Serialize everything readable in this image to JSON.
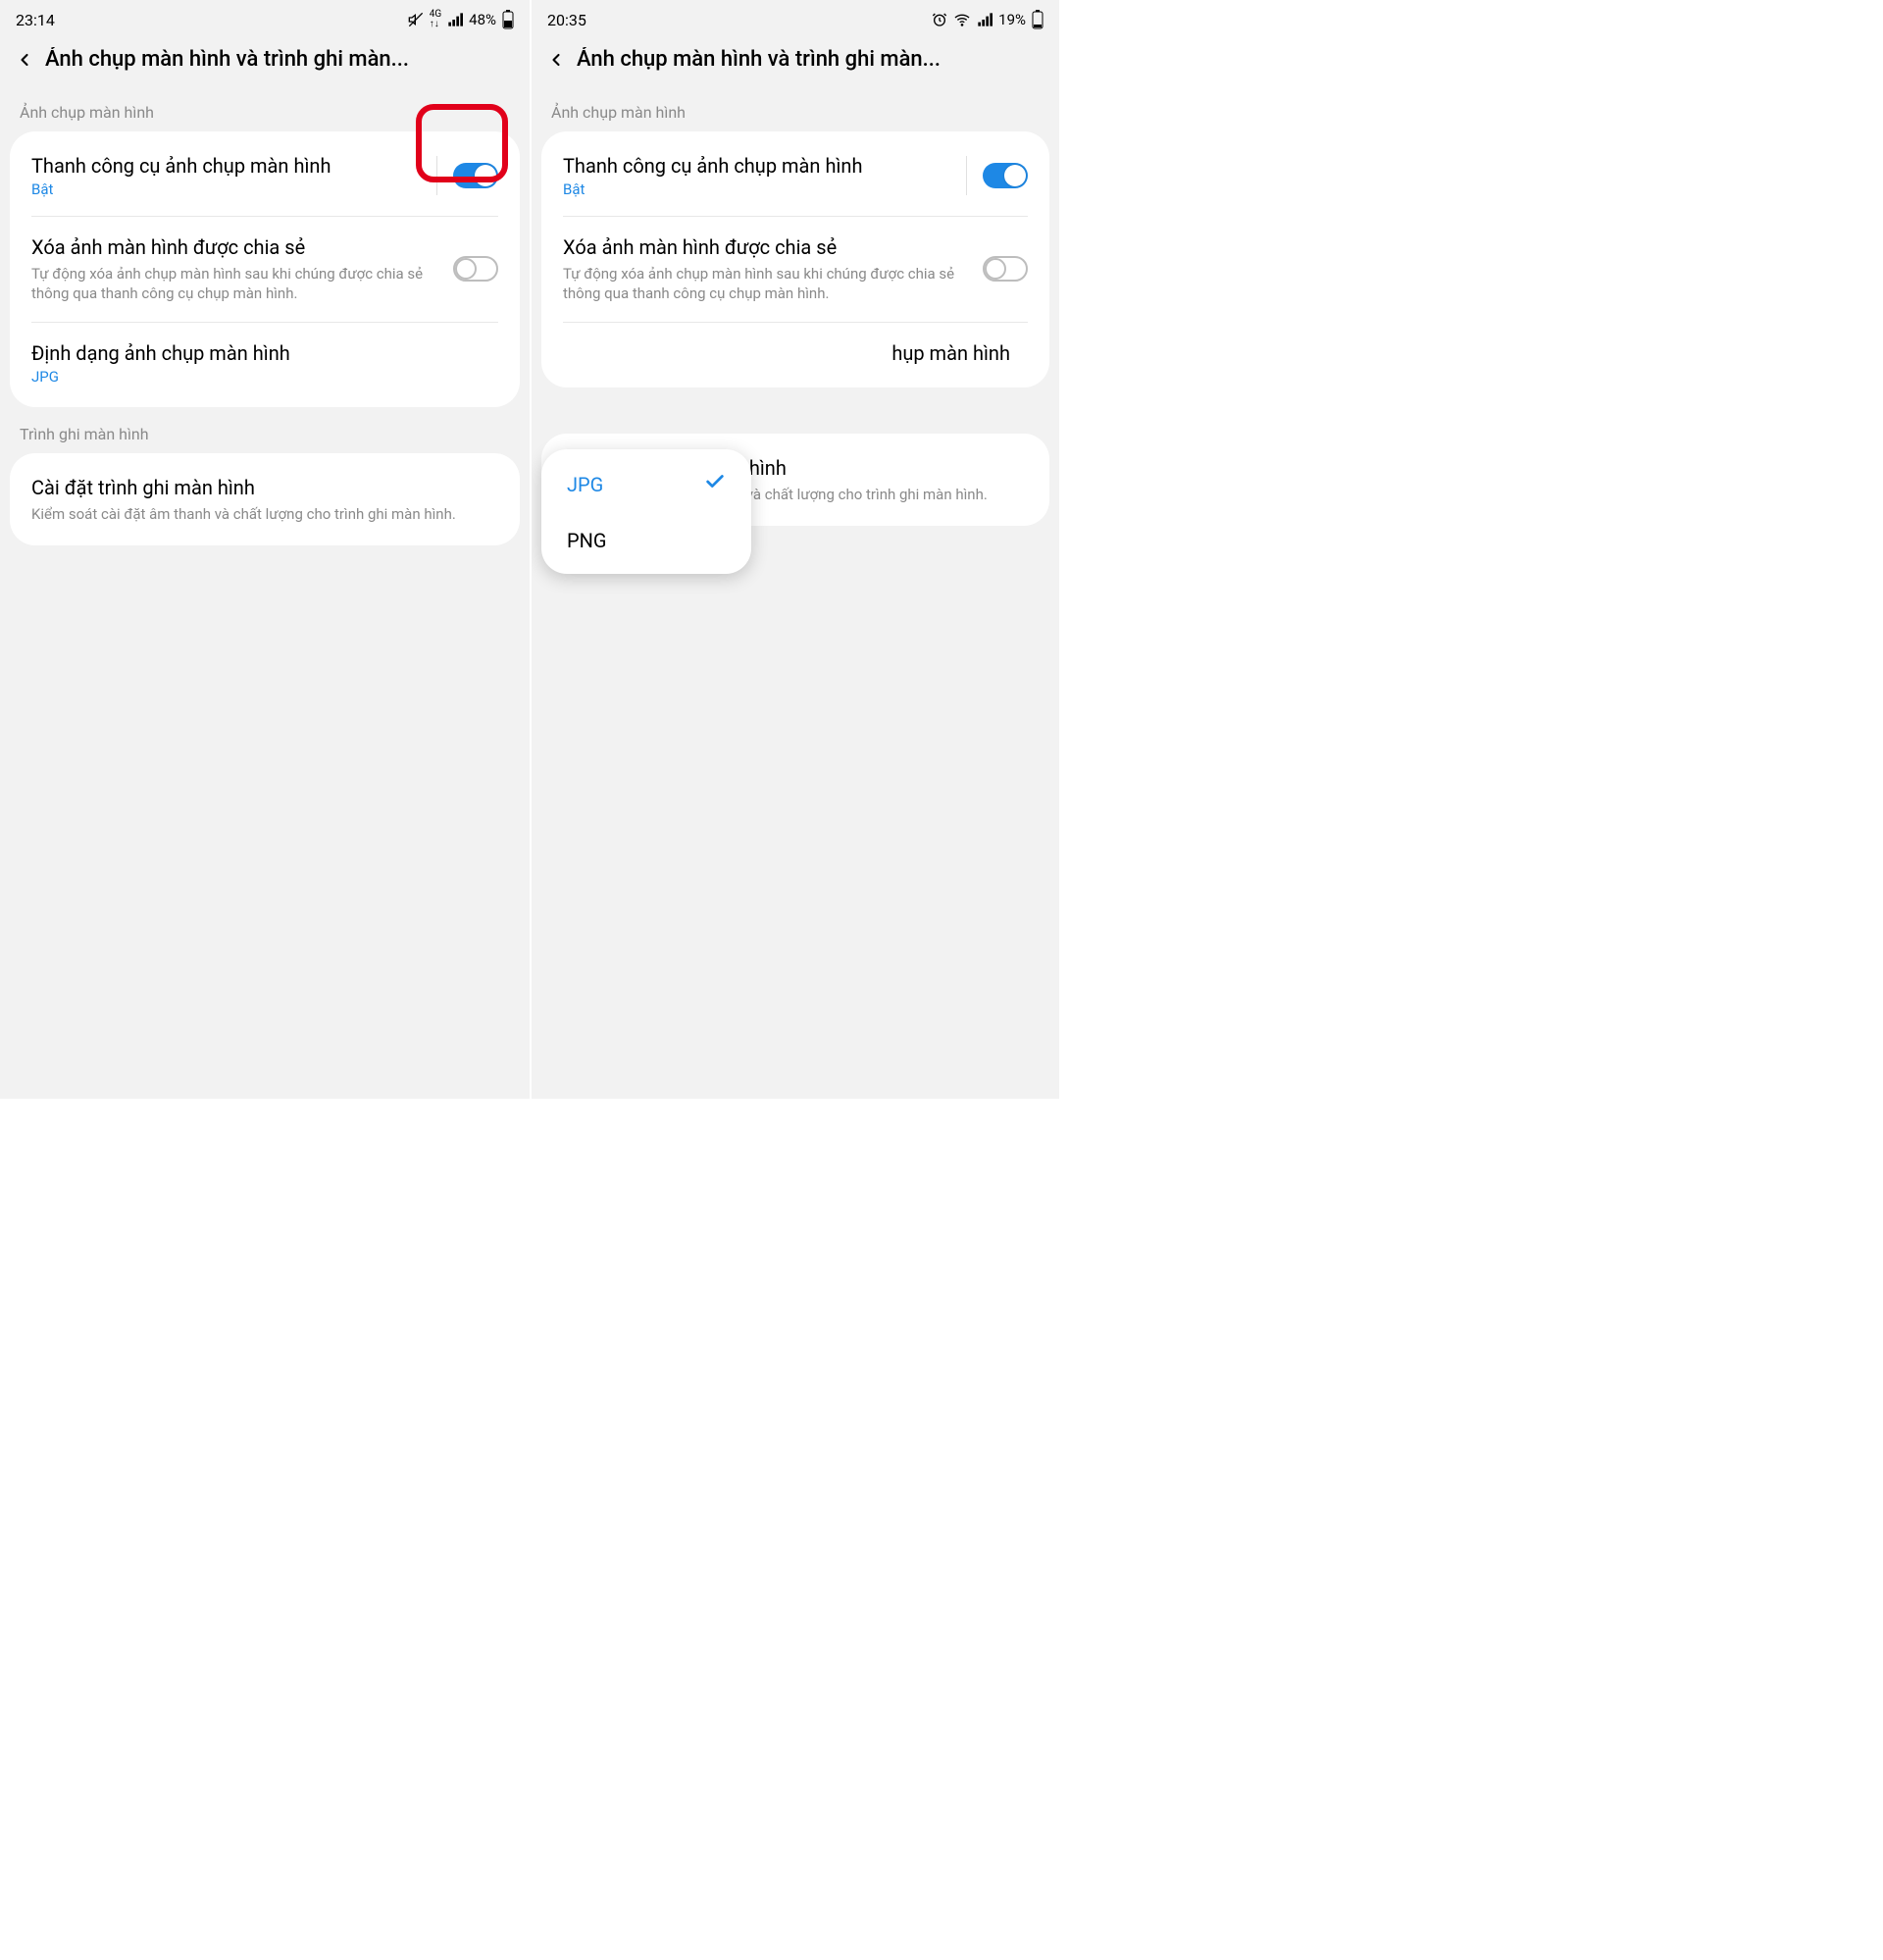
{
  "left": {
    "status": {
      "time": "23:14",
      "battery": "48%"
    },
    "header": {
      "title": "Ảnh chụp màn hình và trình ghi màn..."
    },
    "section1": {
      "label": "Ảnh chụp màn hình"
    },
    "row_toolbar": {
      "title": "Thanh công cụ ảnh chụp màn hình",
      "sub": "Bật"
    },
    "row_delete": {
      "title": "Xóa ảnh màn hình được chia sẻ",
      "desc": "Tự động xóa ảnh chụp màn hình sau khi chúng được chia sẻ thông qua thanh công cụ chụp màn hình."
    },
    "row_format": {
      "title": "Định dạng ảnh chụp màn hình",
      "sub": "JPG"
    },
    "section2": {
      "label": "Trình ghi màn hình"
    },
    "row_recorder": {
      "title": "Cài đặt trình ghi màn hình",
      "desc": "Kiểm soát cài đặt âm thanh và chất lượng cho trình ghi màn hình."
    }
  },
  "right": {
    "status": {
      "time": "20:35",
      "battery": "19%"
    },
    "header": {
      "title": "Ảnh chụp màn hình và trình ghi màn..."
    },
    "section1": {
      "label": "Ảnh chụp màn hình"
    },
    "row_toolbar": {
      "title": "Thanh công cụ ảnh chụp màn hình",
      "sub": "Bật"
    },
    "row_delete": {
      "title": "Xóa ảnh màn hình được chia sẻ",
      "desc": "Tự động xóa ảnh chụp màn hình sau khi chúng được chia sẻ thông qua thanh công cụ chụp màn hình."
    },
    "row_format": {
      "title_partial": "hụp màn hình"
    },
    "popup": {
      "opt1": "JPG",
      "opt2": "PNG"
    },
    "row_recorder": {
      "title": "Cài đặt trình ghi màn hình",
      "desc": "Kiểm soát cài đặt âm thanh và chất lượng cho trình ghi màn hình."
    }
  }
}
